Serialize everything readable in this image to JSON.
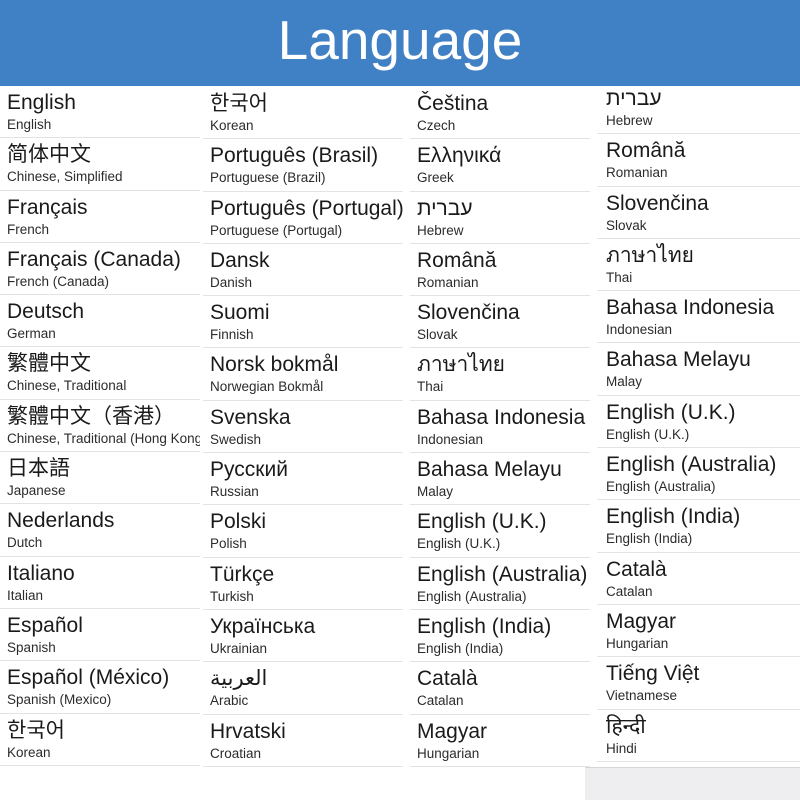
{
  "header": {
    "title": "Language",
    "background_color": "#4080c4",
    "text_color": "#ffffff"
  },
  "theme": {
    "page_background": "#ffffff",
    "separator_color": "#e3e3e3",
    "native_text_color": "#1a1a1a",
    "english_text_color": "#2b2b2b",
    "panel_color": "#eeeef1"
  },
  "columns": [
    {
      "id": "column-1",
      "items": [
        {
          "native": "English",
          "english": "English"
        },
        {
          "native": "简体中文",
          "english": "Chinese, Simplified"
        },
        {
          "native": "Français",
          "english": "French"
        },
        {
          "native": "Français (Canada)",
          "english": "French (Canada)"
        },
        {
          "native": "Deutsch",
          "english": "German"
        },
        {
          "native": "繁體中文",
          "english": "Chinese, Traditional"
        },
        {
          "native": "繁體中文（香港）",
          "english": "Chinese, Traditional (Hong Kong)"
        },
        {
          "native": "日本語",
          "english": "Japanese"
        },
        {
          "native": "Nederlands",
          "english": "Dutch"
        },
        {
          "native": "Italiano",
          "english": "Italian"
        },
        {
          "native": "Español",
          "english": "Spanish"
        },
        {
          "native": "Español (México)",
          "english": "Spanish (Mexico)"
        },
        {
          "native": "한국어",
          "english": "Korean"
        }
      ]
    },
    {
      "id": "column-2",
      "items": [
        {
          "native": "한국어",
          "english": "Korean"
        },
        {
          "native": "Português (Brasil)",
          "english": "Portuguese (Brazil)"
        },
        {
          "native": "Português (Portugal)",
          "english": "Portuguese (Portugal)"
        },
        {
          "native": "Dansk",
          "english": "Danish"
        },
        {
          "native": "Suomi",
          "english": "Finnish"
        },
        {
          "native": "Norsk bokmål",
          "english": "Norwegian Bokmål"
        },
        {
          "native": "Svenska",
          "english": "Swedish"
        },
        {
          "native": "Русский",
          "english": "Russian"
        },
        {
          "native": "Polski",
          "english": "Polish"
        },
        {
          "native": "Türkçe",
          "english": "Turkish"
        },
        {
          "native": "Українська",
          "english": "Ukrainian"
        },
        {
          "native": "العربية",
          "english": "Arabic"
        },
        {
          "native": "Hrvatski",
          "english": "Croatian"
        }
      ]
    },
    {
      "id": "column-3",
      "items": [
        {
          "native": "Čeština",
          "english": "Czech"
        },
        {
          "native": "Ελληνικά",
          "english": "Greek"
        },
        {
          "native": "עברית",
          "english": "Hebrew"
        },
        {
          "native": "Română",
          "english": "Romanian"
        },
        {
          "native": "Slovenčina",
          "english": "Slovak"
        },
        {
          "native": "ภาษาไทย",
          "english": "Thai"
        },
        {
          "native": "Bahasa Indonesia",
          "english": "Indonesian"
        },
        {
          "native": "Bahasa Melayu",
          "english": "Malay"
        },
        {
          "native": "English (U.K.)",
          "english": "English (U.K.)"
        },
        {
          "native": "English (Australia)",
          "english": "English (Australia)"
        },
        {
          "native": "English (India)",
          "english": "English (India)"
        },
        {
          "native": "Català",
          "english": "Catalan"
        },
        {
          "native": "Magyar",
          "english": "Hungarian"
        }
      ]
    },
    {
      "id": "column-4",
      "items": [
        {
          "native": "עברית",
          "english": "Hebrew"
        },
        {
          "native": "Română",
          "english": "Romanian"
        },
        {
          "native": "Slovenčina",
          "english": "Slovak"
        },
        {
          "native": "ภาษาไทย",
          "english": "Thai"
        },
        {
          "native": "Bahasa Indonesia",
          "english": "Indonesian"
        },
        {
          "native": "Bahasa Melayu",
          "english": "Malay"
        },
        {
          "native": "English (U.K.)",
          "english": "English (U.K.)"
        },
        {
          "native": "English (Australia)",
          "english": "English (Australia)"
        },
        {
          "native": "English (India)",
          "english": "English (India)"
        },
        {
          "native": "Català",
          "english": "Catalan"
        },
        {
          "native": "Magyar",
          "english": "Hungarian"
        },
        {
          "native": "Tiếng Việt",
          "english": "Vietnamese"
        },
        {
          "native": "हिन्दी",
          "english": "Hindi"
        }
      ]
    }
  ]
}
